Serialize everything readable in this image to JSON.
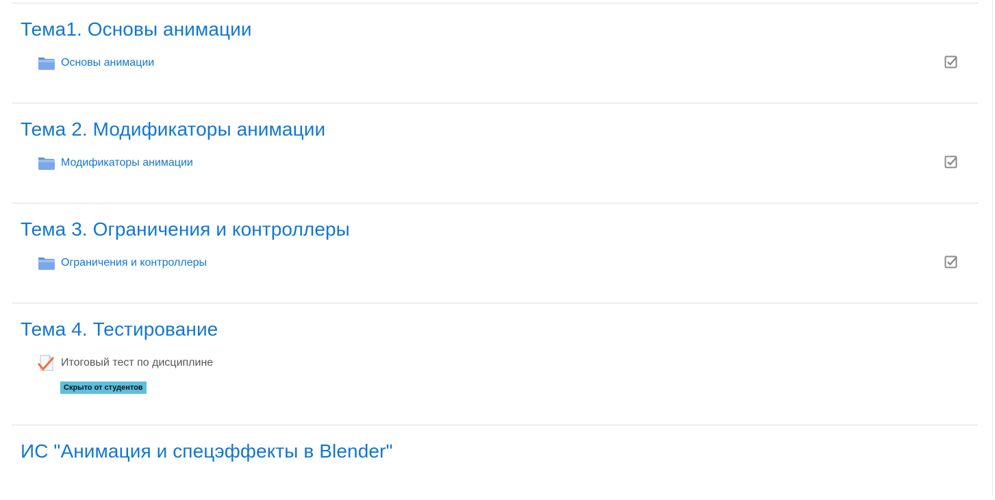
{
  "sections": [
    {
      "title": "Тема1. Основы анимации",
      "activity": {
        "type": "folder",
        "icon": "folder-icon",
        "label": "Основы анимации",
        "completion_icon": "checkbox-checked-icon"
      }
    },
    {
      "title": "Тема 2. Модификаторы анимации",
      "activity": {
        "type": "folder",
        "icon": "folder-icon",
        "label": "Модификаторы анимации",
        "completion_icon": "checkbox-checked-icon"
      }
    },
    {
      "title": "Тема 3. Ограничения и контроллеры",
      "activity": {
        "type": "folder",
        "icon": "folder-icon",
        "label": "Ограничения и контроллеры",
        "completion_icon": "checkbox-checked-icon"
      }
    },
    {
      "title": "Тема 4. Тестирование",
      "activity": {
        "type": "quiz",
        "icon": "quiz-icon",
        "label": "Итоговый тест по дисциплине",
        "badge": "Скрыто от студентов"
      }
    },
    {
      "title": "ИС \"Анимация и спецэффекты в Blender\""
    }
  ],
  "colors": {
    "link": "#1177d1",
    "hidden_text": "#555555",
    "badge_bg": "#5bc0de",
    "divider": "#dddddd"
  }
}
